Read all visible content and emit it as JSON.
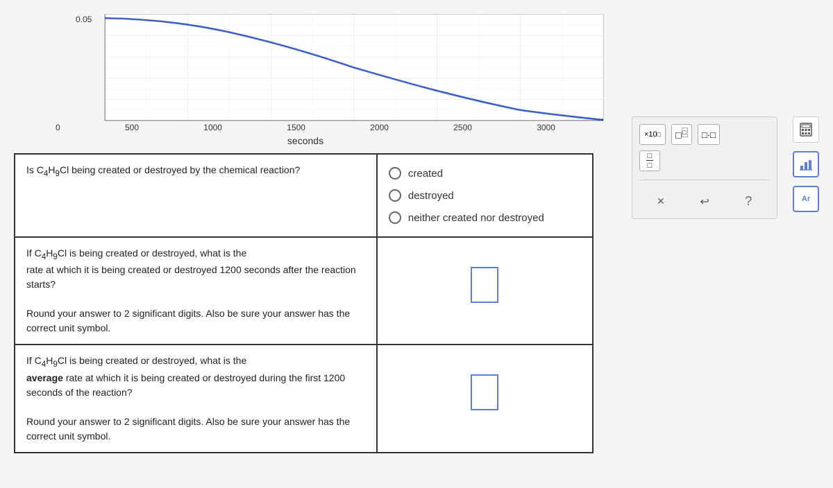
{
  "graph": {
    "x_label": "seconds",
    "x_ticks": [
      "0",
      "500",
      "1000",
      "1500",
      "2000",
      "2500",
      "3000"
    ],
    "y_value": "0.05",
    "curve_color": "#3a5fc8"
  },
  "questions": [
    {
      "id": "q1",
      "question_html": "Is C₄H₉Cl being created or destroyed by the chemical reaction?",
      "answer_type": "radio",
      "options": [
        "created",
        "destroyed",
        "neither created nor destroyed"
      ]
    },
    {
      "id": "q2",
      "question_intro": "If C₄H₉Cl is being created or destroyed, what is the",
      "question_body": "rate at which it is being created or destroyed 1200 seconds after the reaction starts?",
      "question_note": "Round your answer to 2 significant digits. Also be sure your answer has the correct unit symbol.",
      "answer_type": "input"
    },
    {
      "id": "q3",
      "question_intro": "If C₄H₉Cl is being created or destroyed, what is the",
      "question_bold": "average",
      "question_body": "rate at which it is being created or destroyed during the first 1200 seconds of the reaction?",
      "question_note": "Round your answer to 2 significant digits. Also be sure your answer has the correct unit symbol.",
      "answer_type": "input"
    }
  ],
  "toolbar": {
    "x10_label": "×10",
    "superscript_label": "□",
    "dot_label": "·□",
    "fraction_label": "□/□",
    "clear_label": "×",
    "undo_label": "↩",
    "help_label": "?"
  },
  "side_icons": {
    "calculator_label": "🖩",
    "bar_chart_label": "📊",
    "ar_label": "Ar"
  }
}
